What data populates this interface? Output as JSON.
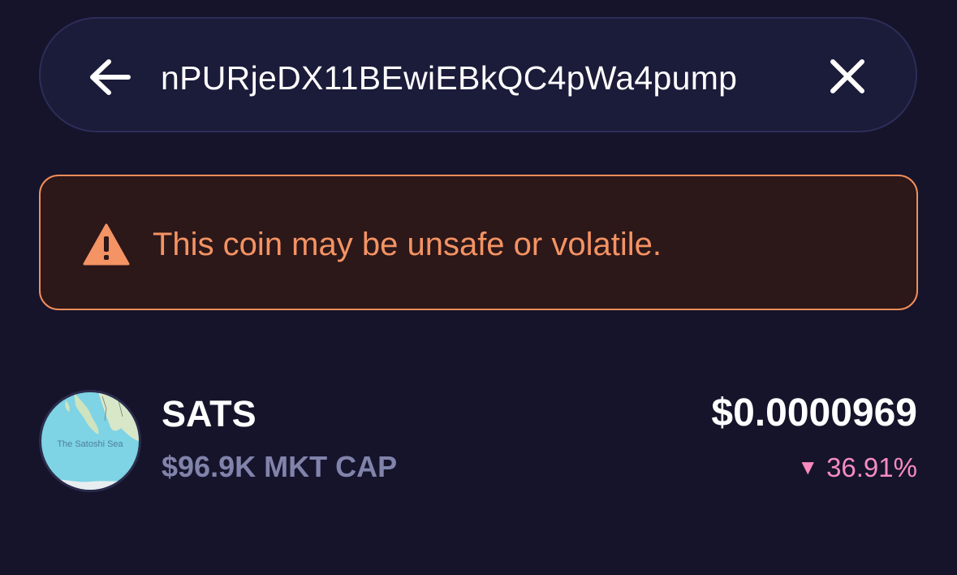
{
  "search": {
    "query_visible": "…nPURjeDX11BEwiEBkQC4pWa4pump",
    "query_shown": "nPURjeDX11BEwiEBkQC4pWa4pump",
    "back_icon": "arrow-left-icon",
    "clear_icon": "close-icon"
  },
  "warning": {
    "icon": "warning-triangle-icon",
    "text": "This coin may be unsafe or volatile.",
    "color": "#f49363"
  },
  "coin": {
    "name": "SATS",
    "market_cap": "$96.9K MKT CAP",
    "price": "$0.0000969",
    "change_direction": "down",
    "change": "36.91%",
    "change_color": "#f78bc0",
    "avatar_caption": "The Satoshi Sea"
  },
  "colors": {
    "background": "#15142b",
    "search_bg": "#1b1b3a",
    "warning_border": "#f28d5a",
    "warning_bg": "#2c1719"
  }
}
